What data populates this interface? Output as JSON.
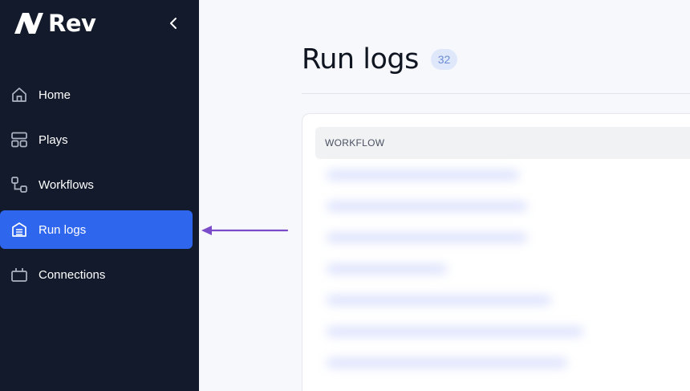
{
  "brand": {
    "name": "Rev"
  },
  "sidebar": {
    "items": [
      {
        "label": "Home",
        "icon": "home-icon",
        "active": false
      },
      {
        "label": "Plays",
        "icon": "layout-icon",
        "active": false
      },
      {
        "label": "Workflows",
        "icon": "workflow-icon",
        "active": false
      },
      {
        "label": "Run logs",
        "icon": "archive-icon",
        "active": true
      },
      {
        "label": "Connections",
        "icon": "connections-icon",
        "active": false
      }
    ]
  },
  "main": {
    "title": "Run logs",
    "count": "32",
    "table": {
      "columns": [
        "WORKFLOW"
      ]
    }
  },
  "colors": {
    "sidebar_bg": "#121a2b",
    "accent": "#2f66ee",
    "annotation_arrow": "#7b4cc9",
    "badge_bg": "#dfe8fb"
  }
}
